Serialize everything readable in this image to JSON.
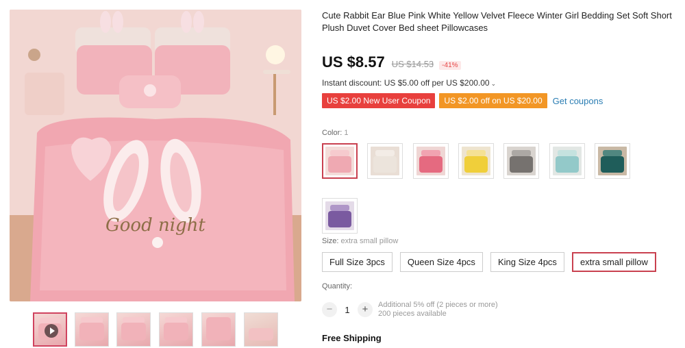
{
  "product": {
    "title": "Cute Rabbit Ear Blue Pink White Yellow Velvet Fleece Winter Girl Bedding Set Soft Short Plush Duvet Cover Bed sheet Pillowcases",
    "photo_caption": "Good night"
  },
  "price": {
    "current": "US $8.57",
    "original": "US $14.53",
    "discount": "-41%"
  },
  "instant_discount": {
    "text": "Instant discount: US $5.00 off per US $200.00"
  },
  "coupons": {
    "new_user": "US $2.00 New User Coupon",
    "store": "US $2.00 off on US $20.00",
    "get_coupons": "Get coupons"
  },
  "color": {
    "label": "Color:",
    "selected": "1",
    "swatches": [
      {
        "bed": "#efa9b2",
        "pillow": "#f6c7cb",
        "bg": "#f4dcd9"
      },
      {
        "bed": "#ece4dc",
        "pillow": "#f5efe9",
        "bg": "#e9ded5"
      },
      {
        "bed": "#e56a80",
        "pillow": "#f19aaa",
        "bg": "#efd6d4"
      },
      {
        "bed": "#f0cf3a",
        "pillow": "#f6e189",
        "bg": "#eee4cf"
      },
      {
        "bed": "#76726f",
        "pillow": "#a3a09c",
        "bg": "#d9d4cf"
      },
      {
        "bed": "#93c9c9",
        "pillow": "#bfe0de",
        "bg": "#e2e7e4"
      },
      {
        "bed": "#1f5d5a",
        "pillow": "#3c7e79",
        "bg": "#c9b9a5"
      },
      {
        "bed": "#7a5aa0",
        "pillow": "#a689c2",
        "bg": "#e4dbe8"
      }
    ]
  },
  "size": {
    "label": "Size:",
    "selected": "extra small pillow",
    "options": [
      "Full Size 3pcs",
      "Queen Size 4pcs",
      "King Size 4pcs",
      "extra small pillow"
    ]
  },
  "quantity": {
    "label": "Quantity:",
    "value": "1",
    "minus": "−",
    "plus": "+",
    "note_discount": "Additional 5% off (2 pieces or more)",
    "note_available": "200 pieces available"
  },
  "shipping": {
    "text": "Free Shipping"
  }
}
